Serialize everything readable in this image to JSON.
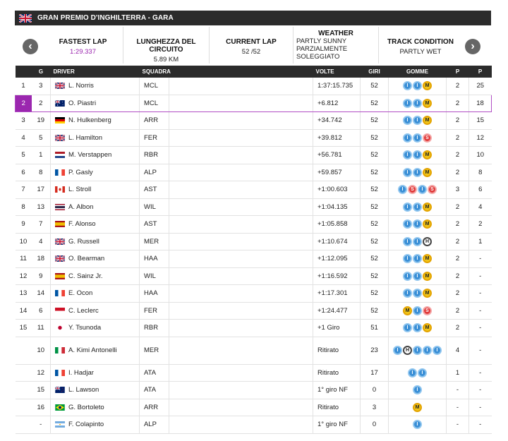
{
  "header": {
    "title": "GRAN PREMIO D'INGHILTERRA - GARA"
  },
  "info": {
    "fastest_lap_label": "FASTEST LAP",
    "fastest_lap_value": "1:29.337",
    "length_label": "LUNGHEZZA DEL CIRCUITO",
    "length_value": "5.89 KM",
    "current_lap_label": "CURRENT LAP",
    "current_lap_value": "52 /52",
    "weather_label": "WEATHER",
    "weather_line1": "PARTLY SUNNY",
    "weather_line2": "PARZIALMENTE",
    "weather_line3": "SOLEGGIATO",
    "track_label": "TRACK CONDITION",
    "track_value": "PARTLY WET"
  },
  "colors": {
    "accent_purple": "#9b27af",
    "header_dark": "#2b2b2b"
  },
  "columns": [
    "",
    "G",
    "DRIVER",
    "SQUADRA",
    "",
    "VOLTE",
    "GIRI",
    "GOMME",
    "P",
    "P"
  ],
  "rows": [
    {
      "pos": "1",
      "grid": "3",
      "flag": "gb",
      "driver": "L. Norris",
      "team": "MCL",
      "time": "1:37:15.735",
      "laps": "52",
      "tyres": [
        "I",
        "I",
        "M"
      ],
      "p": "2",
      "pts": "25"
    },
    {
      "pos": "2",
      "grid": "2",
      "flag": "au",
      "driver": "O. Piastri",
      "team": "MCL",
      "time": "+6.812",
      "laps": "52",
      "tyres": [
        "I",
        "I",
        "M"
      ],
      "p": "2",
      "pts": "18",
      "highlight": true
    },
    {
      "pos": "3",
      "grid": "19",
      "flag": "de",
      "driver": "N. Hulkenberg",
      "team": "ARR",
      "time": "+34.742",
      "laps": "52",
      "tyres": [
        "I",
        "I",
        "M"
      ],
      "p": "2",
      "pts": "15"
    },
    {
      "pos": "4",
      "grid": "5",
      "flag": "gb",
      "driver": "L. Hamilton",
      "team": "FER",
      "time": "+39.812",
      "laps": "52",
      "tyres": [
        "I",
        "I",
        "S"
      ],
      "p": "2",
      "pts": "12"
    },
    {
      "pos": "5",
      "grid": "1",
      "flag": "nl",
      "driver": "M. Verstappen",
      "team": "RBR",
      "time": "+56.781",
      "laps": "52",
      "tyres": [
        "I",
        "I",
        "M"
      ],
      "p": "2",
      "pts": "10"
    },
    {
      "pos": "6",
      "grid": "8",
      "flag": "fr",
      "driver": "P. Gasly",
      "team": "ALP",
      "time": "+59.857",
      "laps": "52",
      "tyres": [
        "I",
        "I",
        "M"
      ],
      "p": "2",
      "pts": "8"
    },
    {
      "pos": "7",
      "grid": "17",
      "flag": "ca",
      "driver": "L. Stroll",
      "team": "AST",
      "time": "+1:00.603",
      "laps": "52",
      "tyres": [
        "I",
        "S",
        "I",
        "S"
      ],
      "p": "3",
      "pts": "6"
    },
    {
      "pos": "8",
      "grid": "13",
      "flag": "th",
      "driver": "A. Albon",
      "team": "WIL",
      "time": "+1:04.135",
      "laps": "52",
      "tyres": [
        "I",
        "I",
        "M"
      ],
      "p": "2",
      "pts": "4"
    },
    {
      "pos": "9",
      "grid": "7",
      "flag": "es",
      "driver": "F. Alonso",
      "team": "AST",
      "time": "+1:05.858",
      "laps": "52",
      "tyres": [
        "I",
        "I",
        "M"
      ],
      "p": "2",
      "pts": "2"
    },
    {
      "pos": "10",
      "grid": "4",
      "flag": "gb",
      "driver": "G. Russell",
      "team": "MER",
      "time": "+1:10.674",
      "laps": "52",
      "tyres": [
        "I",
        "I",
        "H"
      ],
      "p": "2",
      "pts": "1"
    },
    {
      "pos": "11",
      "grid": "18",
      "flag": "gb",
      "driver": "O. Bearman",
      "team": "HAA",
      "time": "+1:12.095",
      "laps": "52",
      "tyres": [
        "I",
        "I",
        "M"
      ],
      "p": "2",
      "pts": "-"
    },
    {
      "pos": "12",
      "grid": "9",
      "flag": "es",
      "driver": "C. Sainz Jr.",
      "team": "WIL",
      "time": "+1:16.592",
      "laps": "52",
      "tyres": [
        "I",
        "I",
        "M"
      ],
      "p": "2",
      "pts": "-"
    },
    {
      "pos": "13",
      "grid": "14",
      "flag": "fr",
      "driver": "E. Ocon",
      "team": "HAA",
      "time": "+1:17.301",
      "laps": "52",
      "tyres": [
        "I",
        "I",
        "M"
      ],
      "p": "2",
      "pts": "-"
    },
    {
      "pos": "14",
      "grid": "6",
      "flag": "mc",
      "driver": "C. Leclerc",
      "team": "FER",
      "time": "+1:24.477",
      "laps": "52",
      "tyres": [
        "M",
        "I",
        "S"
      ],
      "p": "2",
      "pts": "-"
    },
    {
      "pos": "15",
      "grid": "11",
      "flag": "jp",
      "driver": "Y. Tsunoda",
      "team": "RBR",
      "time": "+1 Giro",
      "laps": "51",
      "tyres": [
        "I",
        "I",
        "M"
      ],
      "p": "2",
      "pts": "-"
    },
    {
      "pos": "",
      "grid": "10",
      "flag": "it",
      "driver": "A. Kimi Antonelli",
      "team": "MER",
      "time": "Ritirato",
      "laps": "23",
      "tyres": [
        "I",
        "H",
        "I",
        "I",
        "I"
      ],
      "p": "4",
      "pts": "-",
      "tall": true
    },
    {
      "pos": "",
      "grid": "12",
      "flag": "fr",
      "driver": "I. Hadjar",
      "team": "ATA",
      "time": "Ritirato",
      "laps": "17",
      "tyres": [
        "I",
        "I"
      ],
      "p": "1",
      "pts": "-"
    },
    {
      "pos": "",
      "grid": "15",
      "flag": "nz",
      "driver": "L. Lawson",
      "team": "ATA",
      "time": "1° giro NF",
      "laps": "0",
      "tyres": [
        "I"
      ],
      "p": "-",
      "pts": "-"
    },
    {
      "pos": "",
      "grid": "16",
      "flag": "br",
      "driver": "G. Bortoleto",
      "team": "ARR",
      "time": "Ritirato",
      "laps": "3",
      "tyres": [
        "M"
      ],
      "p": "-",
      "pts": "-"
    },
    {
      "pos": "",
      "grid": "-",
      "flag": "ar",
      "driver": "F. Colapinto",
      "team": "ALP",
      "time": "1° giro NF",
      "laps": "0",
      "tyres": [
        "I"
      ],
      "p": "-",
      "pts": "-"
    }
  ]
}
